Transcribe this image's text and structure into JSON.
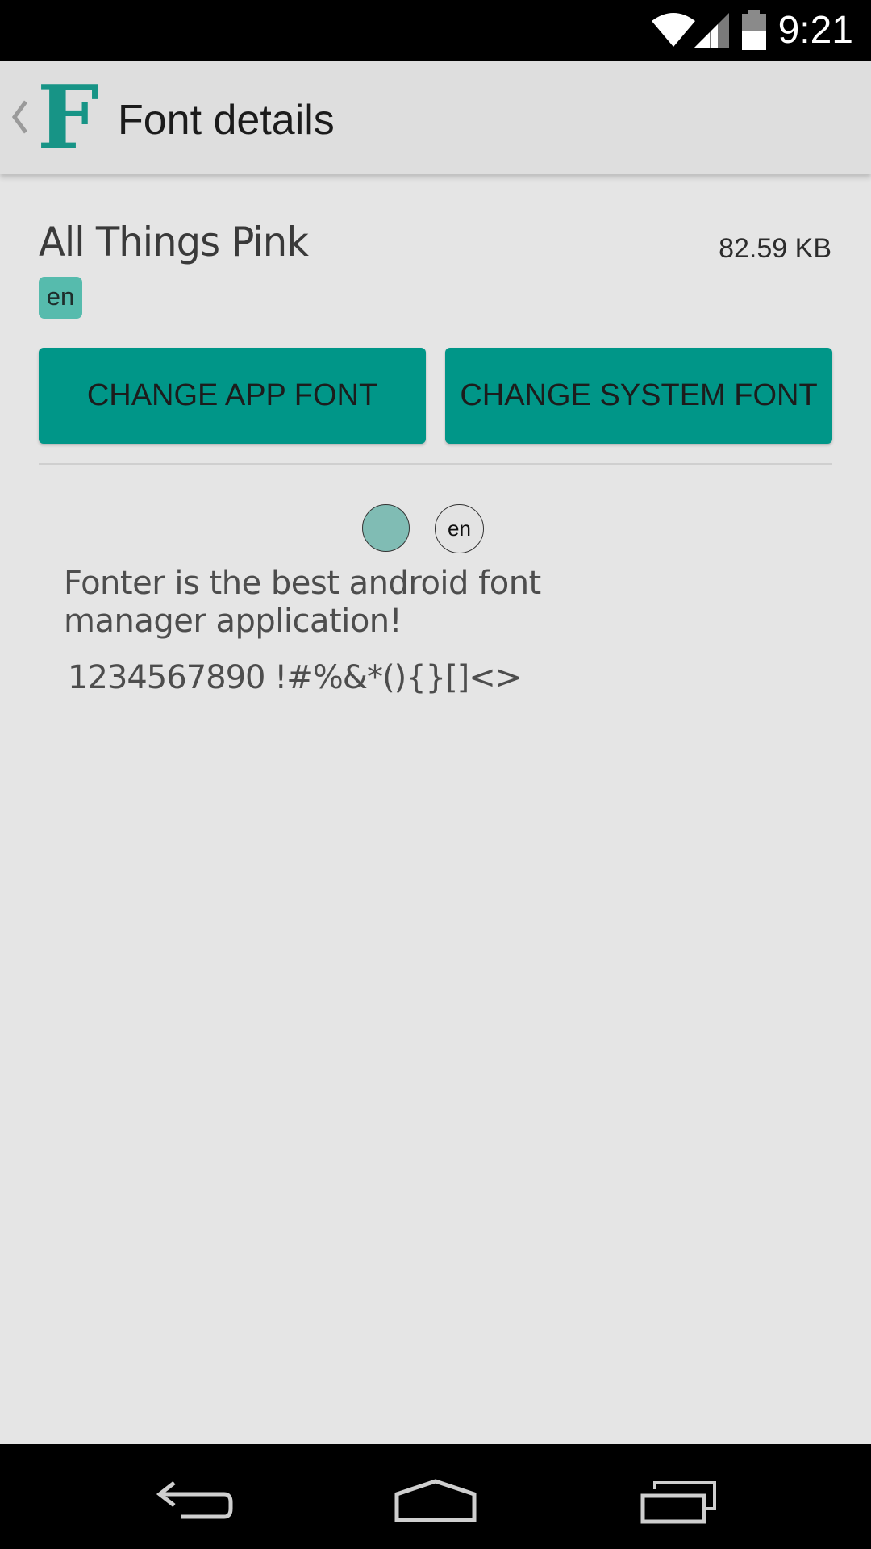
{
  "status_bar": {
    "time": "9:21"
  },
  "action_bar": {
    "logo_letter": "F",
    "title": "Font details"
  },
  "font": {
    "name": "All Things Pink",
    "size": "82.59 KB",
    "language": "en"
  },
  "buttons": {
    "change_app_font": "CHANGE APP FONT",
    "change_system_font": "CHANGE SYSTEM FONT"
  },
  "preview_controls": {
    "color": "#80bcb4",
    "language": "en"
  },
  "preview": {
    "sentence": "Fonter is the best android font manager application!",
    "characters": "1234567890 !#%&*(){}[]<>"
  },
  "colors": {
    "accent": "#009688",
    "tag": "#56bbad",
    "background": "#e5e5e5"
  }
}
